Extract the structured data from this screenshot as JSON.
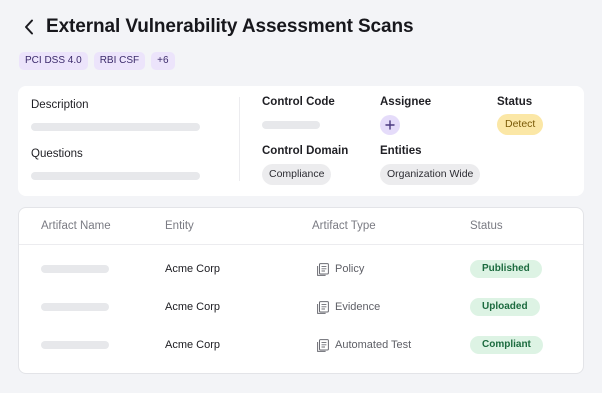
{
  "page": {
    "title": "External Vulnerability Assessment Scans",
    "tags": [
      "PCI DSS 4.0",
      "RBI CSF",
      "+6"
    ]
  },
  "details": {
    "description_label": "Description",
    "questions_label": "Questions",
    "control_code_label": "Control Code",
    "assignee_label": "Assignee",
    "assignee_add_icon": "plus-icon",
    "status_label": "Status",
    "status_value": "Detect",
    "control_domain_label": "Control Domain",
    "control_domain_value": "Compliance",
    "entities_label": "Entities",
    "entities_value": "Organization Wide"
  },
  "artifacts": {
    "columns": [
      "Artifact Name",
      "Entity",
      "Artifact Type",
      "Status"
    ],
    "rows": [
      {
        "entity": "Acme Corp",
        "type": "Policy",
        "type_icon": "document-icon",
        "status": "Published"
      },
      {
        "entity": "Acme Corp",
        "type": "Evidence",
        "type_icon": "document-icon",
        "status": "Uploaded"
      },
      {
        "entity": "Acme Corp",
        "type": "Automated Test",
        "type_icon": "document-icon",
        "status": "Compliant"
      }
    ]
  },
  "colors": {
    "tag_bg": "#ece4fb",
    "detect_bg": "#fbe7a6",
    "success_bg": "#ddf3e4",
    "success_text": "#1c6b3f"
  }
}
